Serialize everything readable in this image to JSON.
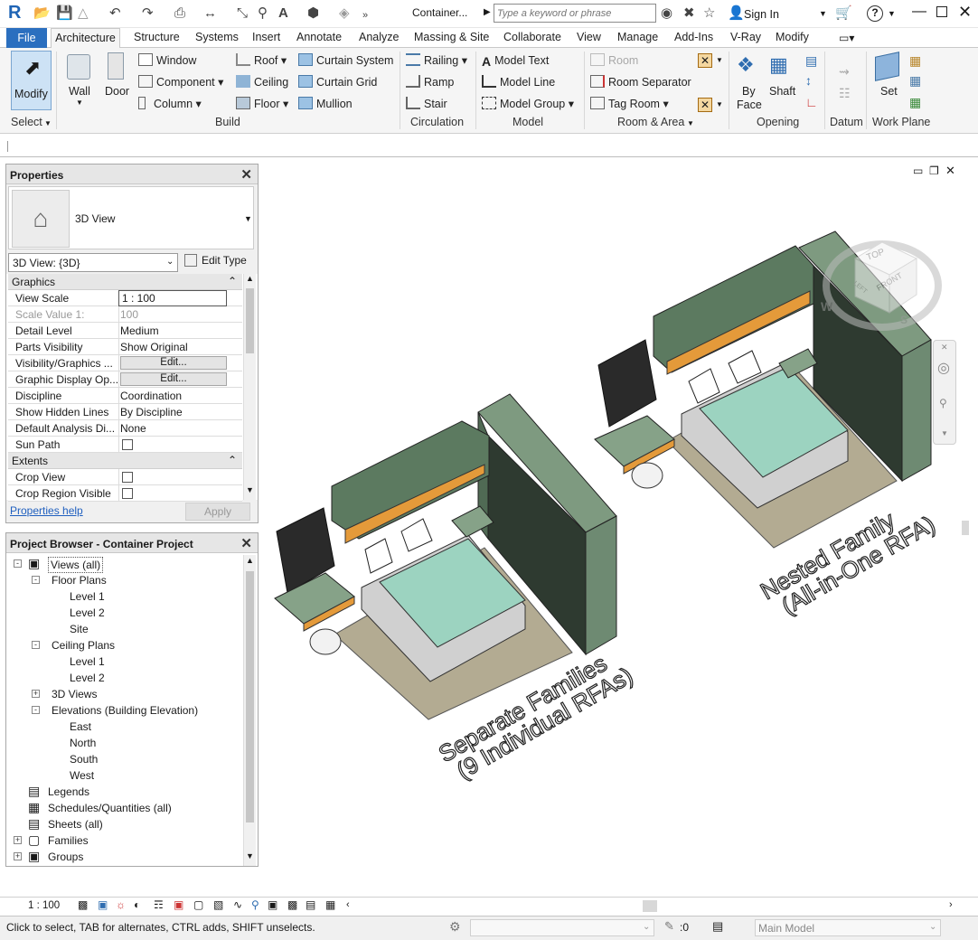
{
  "titlebar": {
    "logo": "R",
    "doc_title": "Container...",
    "search_placeholder": "Type a keyword or phrase",
    "sign_in": "Sign In",
    "help": "?"
  },
  "tabs": [
    "File",
    "Architecture",
    "Structure",
    "Systems",
    "Insert",
    "Annotate",
    "Analyze",
    "Massing & Site",
    "Collaborate",
    "View",
    "Manage",
    "Add-Ins",
    "V-Ray",
    "Modify"
  ],
  "ribbon": {
    "select": {
      "modify": "Modify",
      "label": "Select"
    },
    "build": {
      "wall": "Wall",
      "door": "Door",
      "window": "Window",
      "component": "Component",
      "column": "Column",
      "roof": "Roof",
      "ceiling": "Ceiling",
      "floor": "Floor",
      "curtain_system": "Curtain System",
      "curtain_grid": "Curtain Grid",
      "mullion": "Mullion",
      "label": "Build"
    },
    "circulation": {
      "railing": "Railing",
      "ramp": "Ramp",
      "stair": "Stair",
      "label": "Circulation"
    },
    "model": {
      "model_text": "Model Text",
      "model_line": "Model Line",
      "model_group": "Model Group",
      "label": "Model"
    },
    "room_area": {
      "room": "Room",
      "room_separator": "Room Separator",
      "tag_room": "Tag Room",
      "label": "Room & Area"
    },
    "opening": {
      "by_face_1": "By",
      "by_face_2": "Face",
      "shaft": "Shaft",
      "label": "Opening"
    },
    "datum": {
      "label": "Datum"
    },
    "work_plane": {
      "set": "Set",
      "label": "Work Plane"
    }
  },
  "properties": {
    "title": "Properties",
    "type_name": "3D View",
    "selector": "3D View: {3D}",
    "edit_type": "Edit Type",
    "groups": [
      {
        "name": "Graphics",
        "rows": [
          {
            "key": "View Scale",
            "value": "1 : 100"
          },
          {
            "key": "Scale Value    1:",
            "value": "100"
          },
          {
            "key": "Detail Level",
            "value": "Medium"
          },
          {
            "key": "Parts Visibility",
            "value": "Show Original"
          },
          {
            "key": "Visibility/Graphics ...",
            "value": "Edit..."
          },
          {
            "key": "Graphic Display Op...",
            "value": "Edit..."
          },
          {
            "key": "Discipline",
            "value": "Coordination"
          },
          {
            "key": "Show Hidden Lines",
            "value": "By Discipline"
          },
          {
            "key": "Default Analysis Di...",
            "value": "None"
          },
          {
            "key": "Sun Path",
            "value": ""
          }
        ]
      },
      {
        "name": "Extents",
        "rows": [
          {
            "key": "Crop View",
            "value": ""
          },
          {
            "key": "Crop Region Visible",
            "value": ""
          }
        ]
      }
    ],
    "help_link": "Properties help",
    "apply": "Apply"
  },
  "browser": {
    "title": "Project Browser - Container Project",
    "views_all": "Views (all)",
    "floor_plans": "Floor Plans",
    "fp_items": [
      "Level 1",
      "Level 2",
      "Site"
    ],
    "ceiling_plans": "Ceiling Plans",
    "cp_items": [
      "Level 1",
      "Level 2"
    ],
    "views3d": "3D Views",
    "elevations": "Elevations (Building Elevation)",
    "el_items": [
      "East",
      "North",
      "South",
      "West"
    ],
    "legends": "Legends",
    "schedules": "Schedules/Quantities (all)",
    "sheets": "Sheets (all)",
    "families": "Families",
    "groups": "Groups"
  },
  "canvas": {
    "label_left_1": "Separate Families",
    "label_left_2": "(9 Individual RFAs)",
    "label_right_1": "Nested Family",
    "label_right_2": "(All-in-One RFA)",
    "viewcube_top": "TOP",
    "viewcube_front": "FRONT",
    "viewcube_left": "LEFT",
    "compass_w": "W",
    "compass_s": "S"
  },
  "viewbar": {
    "scale": "1 : 100"
  },
  "status": {
    "message": "Click to select, TAB for alternates, CTRL adds, SHIFT unselects.",
    "filter_count": ":0",
    "model": "Main Model"
  },
  "colors": {
    "accent": "#2b6fbf",
    "cabinet": "#6e8a72",
    "bed": "#9cd3c0",
    "wood": "#e49a3a",
    "rug": "#b3ab92"
  }
}
